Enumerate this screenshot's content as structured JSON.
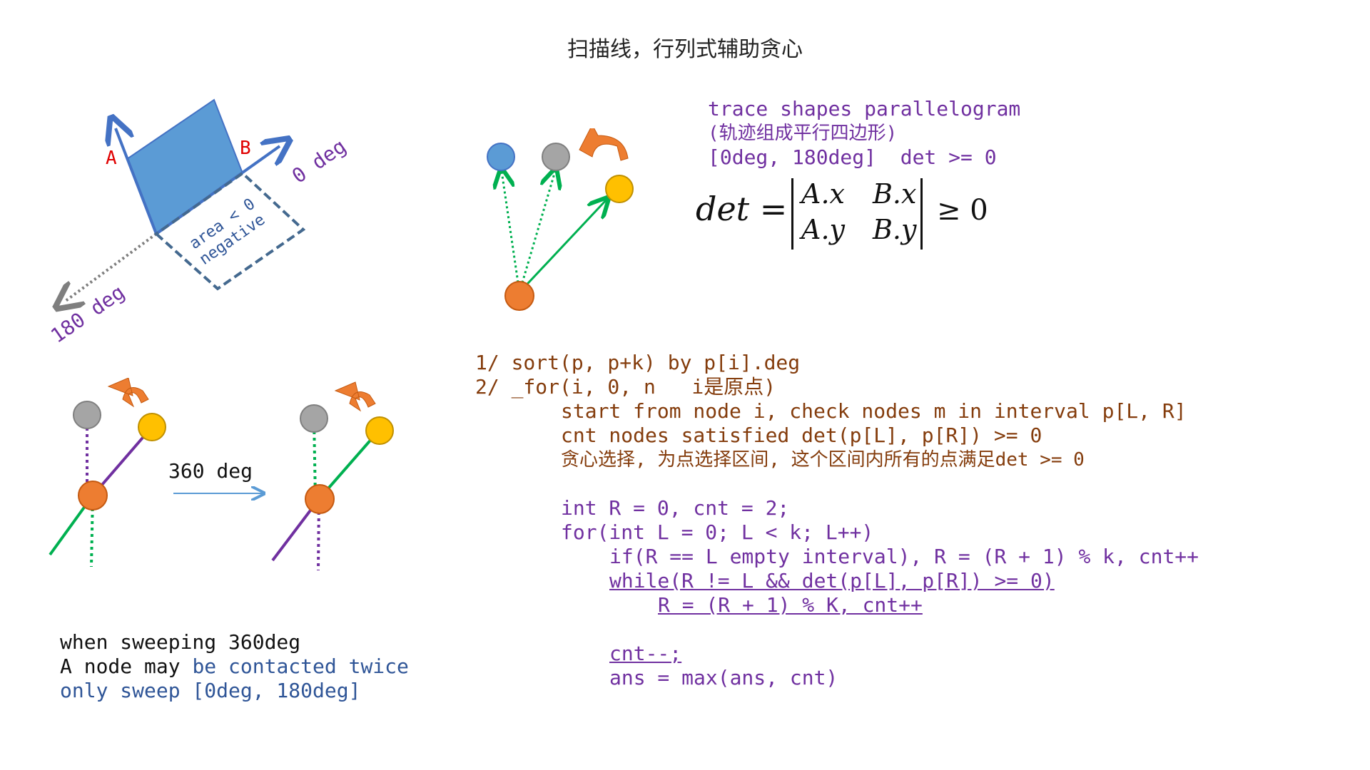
{
  "title": "扫描线，行列式辅助贪心",
  "top_left_diagram": {
    "label_a": "A",
    "label_b": "B",
    "label_0deg": "0 deg",
    "label_180deg": "180 deg",
    "label_area": "area < 0",
    "label_negative": "negative"
  },
  "sweep_diagram": {
    "label_360": "360 deg"
  },
  "trace_text": {
    "line1": "trace shapes parallelogram",
    "line2": "(轨迹组成平行四边形)",
    "line3": "[0deg, 180deg]  det >= 0"
  },
  "formula": {
    "lhs": "det =",
    "a_x": "A.x",
    "b_x": "B.x",
    "a_y": "A.y",
    "b_y": "B.y",
    "rhs": "≥ 0"
  },
  "code": {
    "l1": "1/ sort(p, p+k) by p[i].deg",
    "l2": "2/ _for(i, 0, n   i是原点)",
    "l3": "start from node i, check nodes m in interval p[L, R]",
    "l4": "cnt nodes satisfied det(p[L], p[R]) >= 0",
    "l5": "贪心选择, 为点选择区间, 这个区间内所有的点满足det >= 0",
    "l6": "int R = 0, cnt = 2;",
    "l7": "for(int L = 0; L < k; L++)",
    "l8": "if(R == L empty interval), R = (R + 1) % k, cnt++",
    "l9": "while(R != L && det(p[L], p[R]) >= 0)",
    "l10": "R = (R + 1) % K, cnt++",
    "l11": "cnt--;",
    "l12": "ans = max(ans, cnt)"
  },
  "note": {
    "l1": "when sweeping 360deg",
    "l2a": "A node may ",
    "l2b": "be contacted twice",
    "l3": "only sweep [0deg, 180deg]"
  },
  "colors": {
    "purple": "#7030a0",
    "brown": "#843c0c",
    "blue_text": "#2f5597",
    "orange_node": "#ed7d31",
    "gray_node": "#a5a5a5",
    "yellow_node": "#ffc000",
    "blue_node": "#5b9bd5",
    "green_line": "#00b050"
  }
}
